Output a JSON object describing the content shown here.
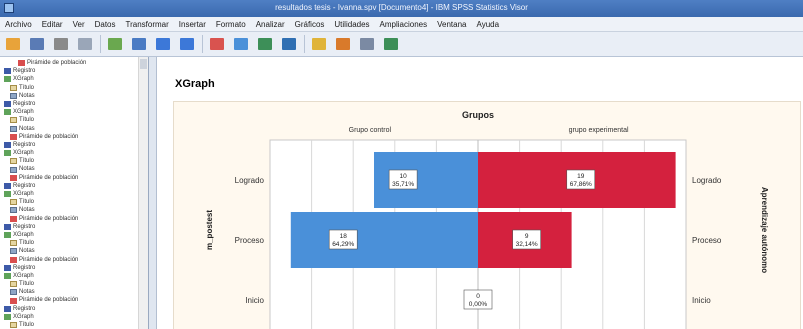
{
  "window": {
    "title": "resultados tesis - Ivanna.spv [Documento4] - IBM SPSS Statistics Visor"
  },
  "menu": [
    "Archivo",
    "Editar",
    "Ver",
    "Datos",
    "Transformar",
    "Insertar",
    "Formato",
    "Analizar",
    "Gráficos",
    "Utilidades",
    "Ampliaciones",
    "Ventana",
    "Ayuda"
  ],
  "toolbar_icons": [
    "open-icon",
    "save-icon",
    "print-icon",
    "print-preview-icon",
    "export-icon",
    "recall-dialog-icon",
    "undo-icon",
    "redo-icon",
    "goto-data-icon",
    "goto-case-icon",
    "goto-variable-icon",
    "variables-icon",
    "create-title-icon",
    "create-text-icon",
    "designate-window-icon",
    "show-hide-icon"
  ],
  "nav": {
    "items": [
      {
        "label": "Pirámide de población",
        "icon": "pyramid-icon",
        "depth": 2
      },
      {
        "label": "Registro",
        "icon": "log-icon",
        "depth": 0
      },
      {
        "label": "XGraph",
        "icon": "graph-icon",
        "depth": 0
      },
      {
        "label": "Título",
        "icon": "title-icon",
        "depth": 1
      },
      {
        "label": "Notas",
        "icon": "notes-icon",
        "depth": 1
      },
      {
        "label": "Registro",
        "icon": "log-icon",
        "depth": 0
      },
      {
        "label": "XGraph",
        "icon": "graph-icon",
        "depth": 0
      },
      {
        "label": "Título",
        "icon": "title-icon",
        "depth": 1
      },
      {
        "label": "Notas",
        "icon": "notes-icon",
        "depth": 1
      },
      {
        "label": "Pirámide de población",
        "icon": "pyramid-icon",
        "depth": 1
      },
      {
        "label": "Registro",
        "icon": "log-icon",
        "depth": 0
      },
      {
        "label": "XGraph",
        "icon": "graph-icon",
        "depth": 0
      },
      {
        "label": "Título",
        "icon": "title-icon",
        "depth": 1
      },
      {
        "label": "Notas",
        "icon": "notes-icon",
        "depth": 1
      },
      {
        "label": "Pirámide de población",
        "icon": "pyramid-icon",
        "depth": 1
      },
      {
        "label": "Registro",
        "icon": "log-icon",
        "depth": 0
      },
      {
        "label": "XGraph",
        "icon": "graph-icon",
        "depth": 0
      },
      {
        "label": "Título",
        "icon": "title-icon",
        "depth": 1
      },
      {
        "label": "Notas",
        "icon": "notes-icon",
        "depth": 1
      },
      {
        "label": "Pirámide de población",
        "icon": "pyramid-icon",
        "depth": 1
      },
      {
        "label": "Registro",
        "icon": "log-icon",
        "depth": 0
      },
      {
        "label": "XGraph",
        "icon": "graph-icon",
        "depth": 0
      },
      {
        "label": "Título",
        "icon": "title-icon",
        "depth": 1
      },
      {
        "label": "Notas",
        "icon": "notes-icon",
        "depth": 1
      },
      {
        "label": "Pirámide de población",
        "icon": "pyramid-icon",
        "depth": 1
      },
      {
        "label": "Registro",
        "icon": "log-icon",
        "depth": 0
      },
      {
        "label": "XGraph",
        "icon": "graph-icon",
        "depth": 0
      },
      {
        "label": "Título",
        "icon": "title-icon",
        "depth": 1
      },
      {
        "label": "Notas",
        "icon": "notes-icon",
        "depth": 1
      },
      {
        "label": "Pirámide de población",
        "icon": "pyramid-icon",
        "depth": 1
      },
      {
        "label": "Registro",
        "icon": "log-icon",
        "depth": 0
      },
      {
        "label": "XGraph",
        "icon": "graph-icon",
        "depth": 0
      },
      {
        "label": "Título",
        "icon": "title-icon",
        "depth": 1
      }
    ]
  },
  "output": {
    "heading": "XGraph"
  },
  "chart_data": {
    "type": "bar",
    "title": "Grupos",
    "panels": [
      "Grupo control",
      "grupo experimental"
    ],
    "categories": [
      "Logrado",
      "Proceso",
      "Inicio"
    ],
    "left_ylabel": "m_postest",
    "right_ylabel": "Aprendizaje autónomo",
    "series": [
      {
        "name": "Grupo control",
        "counts": [
          10,
          18,
          0
        ],
        "percents": [
          "35,71%",
          "64,29%",
          "0,00%"
        ],
        "color": "#4a90d9"
      },
      {
        "name": "grupo experimental",
        "counts": [
          19,
          9,
          0
        ],
        "percents": [
          "67,86%",
          "32,14%",
          "0,00%"
        ],
        "color": "#d4213e"
      }
    ],
    "count_axis_max": 20,
    "grid": true
  }
}
